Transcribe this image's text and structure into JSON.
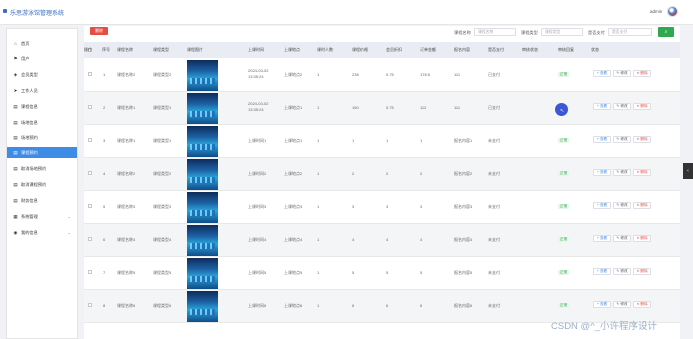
{
  "header": {
    "title": "乐思游泳馆管理系统",
    "user": "admin"
  },
  "sidebar": {
    "items": [
      {
        "label": "首页",
        "icon": "home-icon",
        "glyph": "⌂"
      },
      {
        "label": "用户",
        "icon": "flag-icon",
        "glyph": "⚑"
      },
      {
        "label": "会员类型",
        "icon": "tag-icon",
        "glyph": "◈"
      },
      {
        "label": "工作人员",
        "icon": "send-icon",
        "glyph": "➤"
      },
      {
        "label": "课程信息",
        "icon": "doc-icon",
        "glyph": "▤"
      },
      {
        "label": "场地信息",
        "icon": "doc-icon",
        "glyph": "▤"
      },
      {
        "label": "场地预约",
        "icon": "doc-icon",
        "glyph": "▤"
      },
      {
        "label": "课程预约",
        "icon": "doc-icon",
        "glyph": "▤"
      },
      {
        "label": "取消场地预约",
        "icon": "doc-icon",
        "glyph": "▤"
      },
      {
        "label": "取消课程预约",
        "icon": "doc-icon",
        "glyph": "▤"
      },
      {
        "label": "财务信息",
        "icon": "doc-icon",
        "glyph": "▤"
      },
      {
        "label": "系统管理",
        "icon": "grid-icon",
        "glyph": "▦"
      },
      {
        "label": "我的信息",
        "icon": "user-icon",
        "glyph": "◉"
      }
    ]
  },
  "toolbar": {
    "delete_label": "删除",
    "search_fields": [
      {
        "label": "课程名称",
        "placeholder": "课程名称"
      },
      {
        "label": "课程类型",
        "placeholder": "课程类型"
      },
      {
        "label": "是否支付",
        "placeholder": "是否支付"
      }
    ],
    "search_button_glyph": "⌕"
  },
  "table": {
    "columns": [
      "序号",
      "课程名称",
      "课程类型",
      "课程图片",
      "上课时间",
      "上课地点",
      "课时人数",
      "课程价格",
      "会员折扣",
      "订单金额",
      "报名内容",
      "是否支付",
      "审核状态",
      "审核回复",
      "状态",
      "操作"
    ],
    "rows": [
      {
        "no": "1",
        "name": "课程名称2",
        "type": "课程类型2",
        "time": "2024-03-02 13:35:24",
        "place": "上课地点2",
        "people": "1",
        "price": "238",
        "discount": "0.75",
        "amount": "178.5",
        "content": "111",
        "paid": "已支付",
        "audit": "",
        "reply": "",
        "status": "正常"
      },
      {
        "no": "2",
        "name": "课程名称1",
        "type": "课程类型1",
        "time": "2024-03-02 13:35:24",
        "place": "上课地点1",
        "people": "1",
        "price": "150",
        "discount": "0.75",
        "amount": "112",
        "content": "111",
        "paid": "已支付",
        "audit": "",
        "reply": "",
        "status": "正常"
      },
      {
        "no": "3",
        "name": "课程名称1",
        "type": "课程类型1",
        "time": "上课时间1",
        "place": "上课地点1",
        "people": "1",
        "price": "1",
        "discount": "1",
        "amount": "1",
        "content": "报名内容1",
        "paid": "未支付",
        "audit": "",
        "reply": "",
        "status": "正常"
      },
      {
        "no": "4",
        "name": "课程名称2",
        "type": "课程类型2",
        "time": "上课时间2",
        "place": "上课地点2",
        "people": "1",
        "price": "2",
        "discount": "2",
        "amount": "2",
        "content": "报名内容2",
        "paid": "未支付",
        "audit": "",
        "reply": "",
        "status": "正常"
      },
      {
        "no": "5",
        "name": "课程名称3",
        "type": "课程类型3",
        "time": "上课时间3",
        "place": "上课地点3",
        "people": "1",
        "price": "3",
        "discount": "3",
        "amount": "3",
        "content": "报名内容3",
        "paid": "未支付",
        "audit": "",
        "reply": "",
        "status": "正常"
      },
      {
        "no": "6",
        "name": "课程名称4",
        "type": "课程类型4",
        "time": "上课时间4",
        "place": "上课地点4",
        "people": "1",
        "price": "4",
        "discount": "4",
        "amount": "4",
        "content": "报名内容4",
        "paid": "未支付",
        "audit": "",
        "reply": "",
        "status": "正常"
      },
      {
        "no": "7",
        "name": "课程名称5",
        "type": "课程类型5",
        "time": "上课时间5",
        "place": "上课地点5",
        "people": "1",
        "price": "5",
        "discount": "5",
        "amount": "5",
        "content": "报名内容5",
        "paid": "未支付",
        "audit": "",
        "reply": "",
        "status": "正常"
      },
      {
        "no": "8",
        "name": "课程名称6",
        "type": "课程类型6",
        "time": "上课时间6",
        "place": "上课地点6",
        "people": "1",
        "price": "6",
        "discount": "6",
        "amount": "6",
        "content": "报名内容6",
        "paid": "未支付",
        "audit": "",
        "reply": "",
        "status": "正常"
      }
    ],
    "actions": {
      "view": "+ 查看",
      "edit": "✎ 修改",
      "delete": "✕ 删除"
    }
  },
  "right_handle_glyph": "‹",
  "watermark": "CSDN @^_小许程序设计",
  "colors": {
    "accent": "#3f8ce6",
    "danger": "#e54d42",
    "success": "#2fa84f"
  }
}
